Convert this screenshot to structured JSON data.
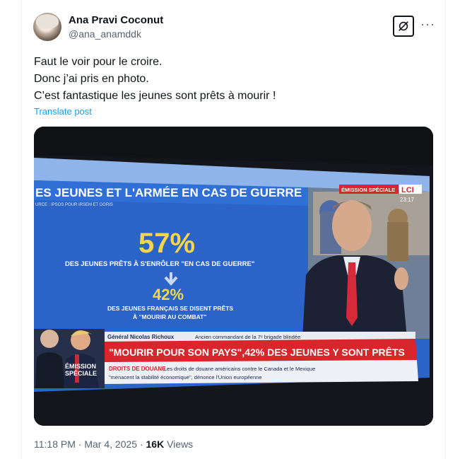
{
  "author": {
    "name": "Ana Pravi Coconut",
    "handle": "@ana_anamddk"
  },
  "actions": {
    "grok_icon": "grok-icon",
    "more_icon": "more-icon",
    "more_glyph": "···"
  },
  "post": {
    "lines": [
      "Faut le voir pour le croire.",
      "Donc j’ai pris en photo.",
      "C’est fantastique les jeunes sont prêts à mourir !"
    ],
    "translate": "Translate post"
  },
  "photo": {
    "headline": "ES JEUNES ET L'ARMÉE EN CAS DE GUERRE",
    "source": "URCE : IPSOS POUR IRSEM ET DGRIS",
    "stat1": "57%",
    "stat1_caption": "DES JEUNES PRÊTS À S'ENRÔLER \"EN CAS DE GUERRE\"",
    "stat2": "42%",
    "stat2_caption_1": "DES JEUNES FRANÇAIS SE DISENT PRÊTS",
    "stat2_caption_2": "À \"MOURIR AU COMBAT\"",
    "badge": "ÉMISSION SPÉCIALE",
    "channel": "LCI",
    "time": "23:17",
    "guest_name": "Général Nicolas Richoux",
    "guest_title": "Ancien commandant de la 7ᵉ brigade blindée",
    "ticker": "\"MOURIR POUR SON PAYS\",42% DES JEUNES Y SONT PRÊTS",
    "emission_1": "ÉMISSION",
    "emission_2": "SPÉCIALE",
    "news_label": "DROITS DE DOUANE",
    "news_1": "Les droits de douane américains contre le Canada et le Mexique",
    "news_2": "\"menacent la stabilité économique\", dénonce l'Union européenne",
    "colors": {
      "screen_blue": "#2b63c8",
      "accent_red": "#d9262c",
      "stat_yellow": "#f3d64a"
    }
  },
  "meta": {
    "time": "11:18 PM",
    "sep1": "·",
    "date": "Mar 4, 2025",
    "sep2": "·",
    "views_count": "16K",
    "views_label": "Views"
  }
}
